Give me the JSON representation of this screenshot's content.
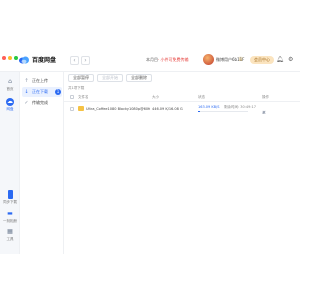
{
  "app": {
    "brand": "百度网盘"
  },
  "header": {
    "notice_prefix": "本月目",
    "notice_text": "· 小件可免费传输",
    "username": "微博用户6b11F",
    "vip_label": "会员中心",
    "accent": "#2b6af2"
  },
  "rail": [
    {
      "label": "首页",
      "icon": "home-icon"
    },
    {
      "label": "网盘",
      "icon": "cloud-icon"
    },
    {
      "label": "同步下载",
      "icon": "sync-icon"
    },
    {
      "label": "一刻相册",
      "icon": "album-icon"
    },
    {
      "label": "工具",
      "icon": "tools-icon"
    }
  ],
  "subnav": [
    {
      "label": "正在上传",
      "icon": "upload-icon"
    },
    {
      "label": "正在下载",
      "icon": "download-icon",
      "badge": "1"
    },
    {
      "label": "传输完成",
      "icon": "done-icon"
    }
  ],
  "toolbar": {
    "pause_all": "全部暂停",
    "start_all": "全部开始",
    "clear_all": "全部删除"
  },
  "list": {
    "meta": "共1项下载",
    "columns": {
      "name": "文件名",
      "size": "大小",
      "status": "状态",
      "actions": "操作"
    },
    "rows": [
      {
        "name": "Ultra_Coffee1080 Blocky1080p@60fr...",
        "size": "446.09 K/16.08 G",
        "speed": "163.09 KB/S",
        "time": "剩余时间: 30:49:17",
        "progress": 0.03
      }
    ]
  }
}
